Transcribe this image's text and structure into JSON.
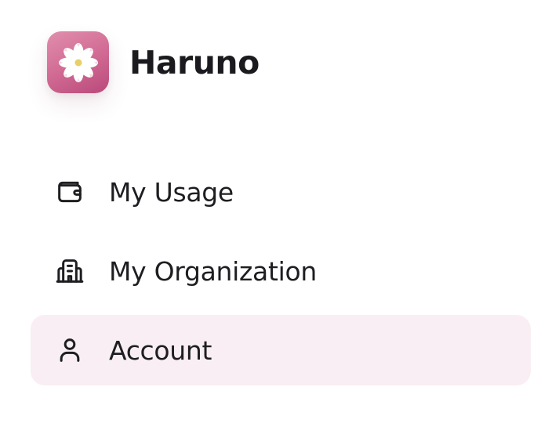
{
  "brand": {
    "name": "Haruno",
    "logo_icon": "flower-icon",
    "logo_colors": {
      "from": "#e08fad",
      "to": "#b9497a",
      "petal": "#ffffff",
      "center": "#e7cf6a"
    }
  },
  "nav": {
    "items": [
      {
        "label": "My Usage",
        "icon": "wallet-icon",
        "active": false
      },
      {
        "label": "My Organization",
        "icon": "building-icon",
        "active": false
      },
      {
        "label": "Account",
        "icon": "user-icon",
        "active": true
      }
    ],
    "active_bg": "#f9eef3"
  }
}
